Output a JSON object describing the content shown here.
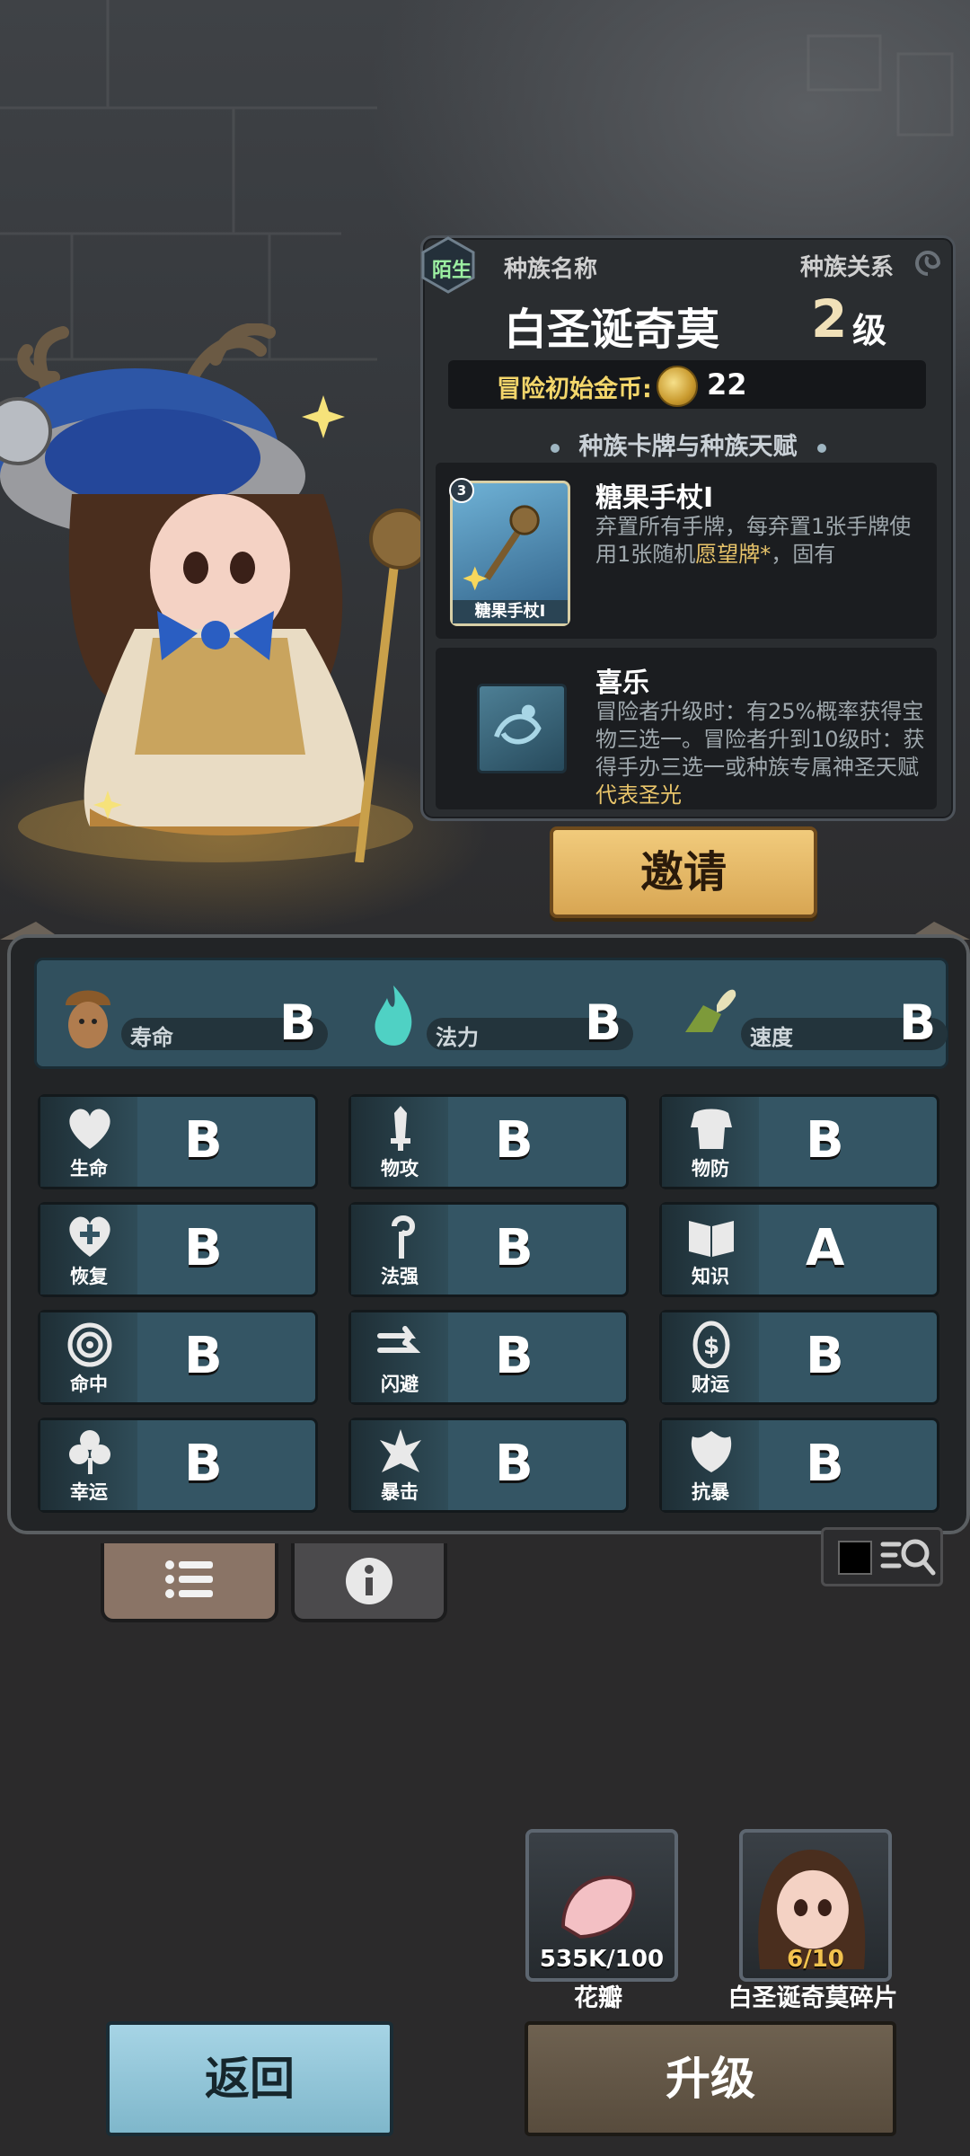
{
  "race": {
    "relation_badge": "陌生",
    "name_label": "种族名称",
    "relation_label": "种族关系",
    "name": "白圣诞奇莫",
    "level_number": "2",
    "level_unit": "级",
    "start_gold_label": "冒险初始金币:",
    "start_gold_value": "22",
    "section_title": "种族卡牌与种族天赋"
  },
  "cards": [
    {
      "badge": "3",
      "thumb_caption": "糖果手杖I",
      "name": "糖果手杖I",
      "desc_plain": "弃置所有手牌，每弃置1张手牌使用1张随机",
      "desc_highlight": "愿望牌*",
      "desc_tail": "，固有"
    },
    {
      "name": "喜乐",
      "desc_plain": "冒险者升级时：有25%概率获得宝物三选一。冒险者升到10级时：获得手办三选一或种族专属神圣天赋",
      "desc_highlight": "代表圣光",
      "desc_tail": ""
    }
  ],
  "invite_button": "邀请",
  "top_stats": [
    {
      "label": "寿命",
      "grade": "B",
      "icon": "acorn-creature-icon"
    },
    {
      "label": "法力",
      "grade": "B",
      "icon": "blue-flame-icon"
    },
    {
      "label": "速度",
      "grade": "B",
      "icon": "winged-boot-icon"
    }
  ],
  "stats": [
    {
      "label": "生命",
      "grade": "B",
      "icon": "heart-icon"
    },
    {
      "label": "物攻",
      "grade": "B",
      "icon": "sword-icon"
    },
    {
      "label": "物防",
      "grade": "B",
      "icon": "armor-icon"
    },
    {
      "label": "恢复",
      "grade": "B",
      "icon": "heart-plus-icon"
    },
    {
      "label": "法强",
      "grade": "B",
      "icon": "staff-icon"
    },
    {
      "label": "知识",
      "grade": "A",
      "icon": "book-icon"
    },
    {
      "label": "命中",
      "grade": "B",
      "icon": "target-icon"
    },
    {
      "label": "闪避",
      "grade": "B",
      "icon": "dodge-arrows-icon"
    },
    {
      "label": "财运",
      "grade": "B",
      "icon": "coin-icon"
    },
    {
      "label": "幸运",
      "grade": "B",
      "icon": "clover-icon"
    },
    {
      "label": "暴击",
      "grade": "B",
      "icon": "crit-burst-icon"
    },
    {
      "label": "抗暴",
      "grade": "B",
      "icon": "shield-shell-icon"
    }
  ],
  "rewards": [
    {
      "name": "花瓣",
      "count": "535K/100",
      "icon": "petal-icon"
    },
    {
      "name": "白圣诞奇莫碎片",
      "count": "6/10",
      "icon": "character-portrait-icon"
    }
  ],
  "back_button": "返回",
  "upgrade_button": "升级",
  "colors": {
    "panel_bg": "#2a2d30",
    "stat_cell_bg": "#345564",
    "invite_gold": "#e4b866",
    "back_blue": "#93c7da",
    "upgrade_brown": "#645745",
    "highlight_text": "#e8c46a"
  }
}
